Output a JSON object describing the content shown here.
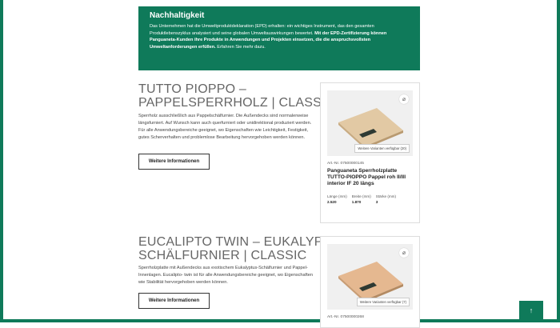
{
  "sustainability": {
    "title": "Nachhaltigkeit",
    "text_a": "Das Unternehmen hat die Umweltproduktdeklaration (EPD) erhalten: ein wichtiges Instrument, das den gesamten Produktlebenszyklus analysiert und seine globalen Umweltauswirkungen bewertet. ",
    "text_bold": "Mit der EPD-Zertifizierung können Panguaneta-Kunden ihre Produkte in Anwendungen und Projekten einsetzen, die die anspruchsvollsten Umweltanforderungen erfüllen.",
    "text_b": " Erfahren Sie mehr dazu."
  },
  "products": [
    {
      "title_line1": "TUTTO PIOPPO –",
      "title_line2": "PAPPELSPERRHOLZ | CLASSIC",
      "description": "Sperrholz ausschließlich aus Pappelschälfurnier. Die Außendecks sind normalerweise längsfurniert. Auf Wunsch kann auch querfurniert oder unidirektional produziert werden. Für alle Anwendungsbereiche geeignet, wo Eigenschaften wie Leichtigkeit, Festigkeit, gutes Scherverhalten und problemlose Bearbeitung hervorgehoben werden können.",
      "button_label": "Weitere Informationen",
      "card": {
        "variants": "Weitere Varianten verfügbar (20)",
        "art": "Art.-Nr. 07500000145",
        "name": "Panguaneta Sperrholzplatte TUTTO-PIOPPO Pappel roh II/III interior IF 20 längs",
        "dims": [
          {
            "label": "Länge (mm)",
            "value": "2.520"
          },
          {
            "label": "Breite (mm)",
            "value": "1.870"
          },
          {
            "label": "Stärke (mm)",
            "value": "3"
          }
        ]
      }
    },
    {
      "title_line1": "EUCALIPTO TWIN – EUKALYPTUS-",
      "title_line2": "SCHÄLFURNIER | CLASSIC",
      "description": "Sperrholzplatte mit Außendecks aus exotischem Eukalyptus-Schälfurnier und Pappel-Innenlagen. Eucalipto- twin ist für alle Anwendungsbereiche geeignet, wo Eigenschaften wie Stabilität hervorgehoben werden können.",
      "button_label": "Weitere Informationen",
      "card": {
        "variants": "Weitere Varianten verfügbar (7)",
        "art": "Art.-Nr. 07500000268"
      }
    }
  ],
  "colors": {
    "brand_green": "#0f7a5a"
  },
  "icons": {
    "pin": "paperclip-icon",
    "top": "arrow-up-icon"
  },
  "scroll_top_symbol": "↑"
}
